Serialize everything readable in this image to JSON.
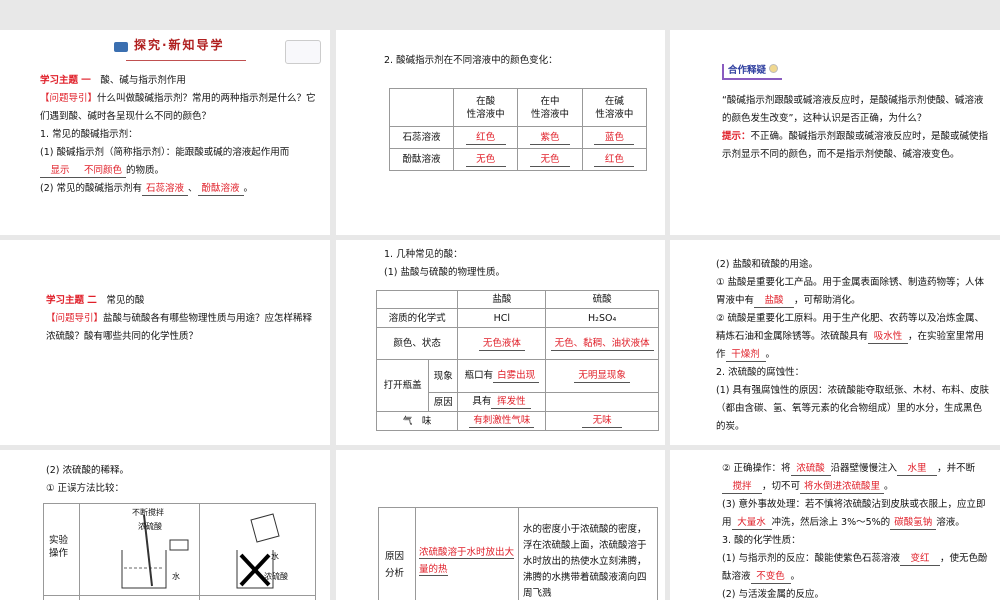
{
  "s1": {
    "header": "探究·新知导学",
    "topic_label": "学习主题 一",
    "topic": "酸、碱与指示剂作用",
    "guide_label": "【问题导引】",
    "guide": "什么叫做酸碱指示剂？常用的两种指示剂是什么？它们遇到酸、碱时各呈现什么不同的颜色？",
    "item1": "1. 常见的酸碱指示剂：",
    "item1a_pre": "(1) 酸碱指示剂（简称指示剂）：能跟酸或碱的溶液起作用而",
    "item1a_ans1": "显示",
    "item1a_ans2": "不同颜色",
    "item1a_post": "的物质。",
    "item1b_pre": "(2) 常见的酸碱指示剂有",
    "item1b_ans1": "石蕊溶液",
    "item1b_sep": "、",
    "item1b_ans2": "酚酞溶液",
    "item1b_post": "。"
  },
  "s2": {
    "title": "2. 酸碱指示剂在不同溶液中的颜色变化：",
    "headers": [
      "",
      "在酸\n性溶液中",
      "在中\n性溶液中",
      "在碱\n性溶液中"
    ],
    "rows": [
      {
        "name": "石蕊溶液",
        "values": [
          "红色",
          "紫色",
          "蓝色"
        ]
      },
      {
        "name": "酚酞溶液",
        "values": [
          "无色",
          "无色",
          "红色"
        ]
      }
    ]
  },
  "s3": {
    "badge": "合作释疑",
    "question": "“酸碱指示剂跟酸或碱溶液反应时，是酸碱指示剂使酸、碱溶液的颜色发生改变”，这种认识是否正确，为什么？",
    "hint_label": "提示：",
    "hint": "不正确。酸碱指示剂跟酸或碱溶液反应时，是酸或碱使指示剂显示不同的颜色，而不是指示剂使酸、碱溶液变色。"
  },
  "s4": {
    "topic_label": "学习主题 二",
    "topic": "常见的酸",
    "guide_label": "【问题导引】",
    "guide": "盐酸与硫酸各有哪些物理性质与用途？应怎样稀释浓硫酸？酸有哪些共同的化学性质？"
  },
  "s5": {
    "line1": "1. 几种常见的酸：",
    "line2": "(1) 盐酸与硫酸的物理性质。",
    "col_hcl": "盐酸",
    "col_h2so4": "硫酸",
    "r_formula": "溶质的化学式",
    "hcl_formula": "HCl",
    "h2so4_formula": "H₂SO₄",
    "r_color": "颜色、状态",
    "hcl_color": "无色液体",
    "h2so4_color": "无色、黏稠、油状液体",
    "r_open": "打开瓶盖",
    "r_phen": "现象",
    "hcl_phen_pre": "瓶口有",
    "hcl_phen": "白雾出现",
    "h2so4_phen": "无明显现象",
    "r_reason": "原因",
    "hcl_reason_pre": "具有",
    "hcl_reason": "挥发性",
    "r_smell": "气　味",
    "hcl_smell": "有刺激性气味",
    "h2so4_smell": "无味"
  },
  "s6": {
    "l1": "(2) 盐酸和硫酸的用途。",
    "l2": "① 盐酸是重要化工产品。用于金属表面除锈、制造药物等；人体胃液中有",
    "a1": "盐酸",
    "l2b": "，可帮助消化。",
    "l3": "② 硫酸是重要化工原料。用于生产化肥、农药等以及冶炼金属、精炼石油和金属除锈等。浓硫酸具有",
    "a2": "吸水性",
    "l3b": "，在实验室里常用作",
    "a3": "干燥剂",
    "l3c": "。",
    "l4": "2. 浓硫酸的腐蚀性：",
    "l5": "(1) 具有强腐蚀性的原因：浓硫酸能夺取纸张、木材、布料、皮肤（都由含碳、氢、氧等元素的化合物组成）里的水分，生成黑色的炭。"
  },
  "s7": {
    "l1": "(2) 浓硫酸的稀释。",
    "l2": "① 正误方法比较：",
    "row_label": "实验\n操作",
    "stir": "不断搅拌",
    "acid": "浓硫酸",
    "water": "水",
    "water2": "水",
    "acid2": "浓硫酸"
  },
  "s8": {
    "row_label": "原因\n分析",
    "correct": "浓硫酸溶于水时放出大量的热",
    "wrong": "水的密度小于浓硫酸的密度，浮在浓硫酸上面，浓硫酸溶于水时放出的热使水立刻沸腾，沸腾的水携带着硫酸液滴向四周飞溅"
  },
  "s9": {
    "l1a": "② 正确操作：将",
    "a1": "浓硫酸",
    "l1b": "沿器壁慢慢注入",
    "a2": "水里",
    "l1c": "，并不断",
    "a3": "搅拌",
    "l1d": "，切不可",
    "a4": "将水倒进浓硫酸里",
    "l1e": "。",
    "l2a": "(3) 意外事故处理：若不慎将浓硫酸沾到皮肤或衣服上，应立即用",
    "a5": "大量水",
    "l2b": "冲洗，然后涂上 3%～5%的",
    "a6": "碳酸氢钠",
    "l2c": "溶液。",
    "l3": "3. 酸的化学性质：",
    "l4a": "(1) 与指示剂的反应：酸能使紫色石蕊溶液",
    "a7": "变红",
    "l4b": "，使无色酚酞溶液",
    "a8": "不变色",
    "l4c": "。",
    "l5": "(2) 与活泼金属的反应。"
  }
}
